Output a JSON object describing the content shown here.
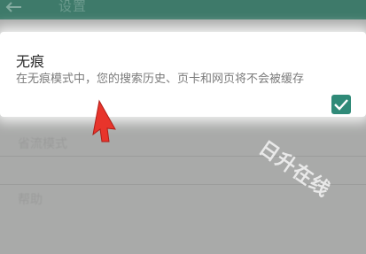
{
  "header": {
    "title": "设置",
    "back_icon": "arrow-left-icon"
  },
  "incognito_setting": {
    "title": "无痕",
    "description": "在无痕模式中，您的搜索历史、页卡和网页将不会被缓存",
    "checked": true
  },
  "background_rows": [
    {
      "label": "省流模式"
    },
    {
      "label": "帮助"
    }
  ],
  "watermark": {
    "text": "日升在线"
  },
  "colors": {
    "accent": "#2f8a78",
    "topbar": "#3e7a6a",
    "dim_background": "#a9aaa9",
    "cursor": "#e8342b"
  }
}
